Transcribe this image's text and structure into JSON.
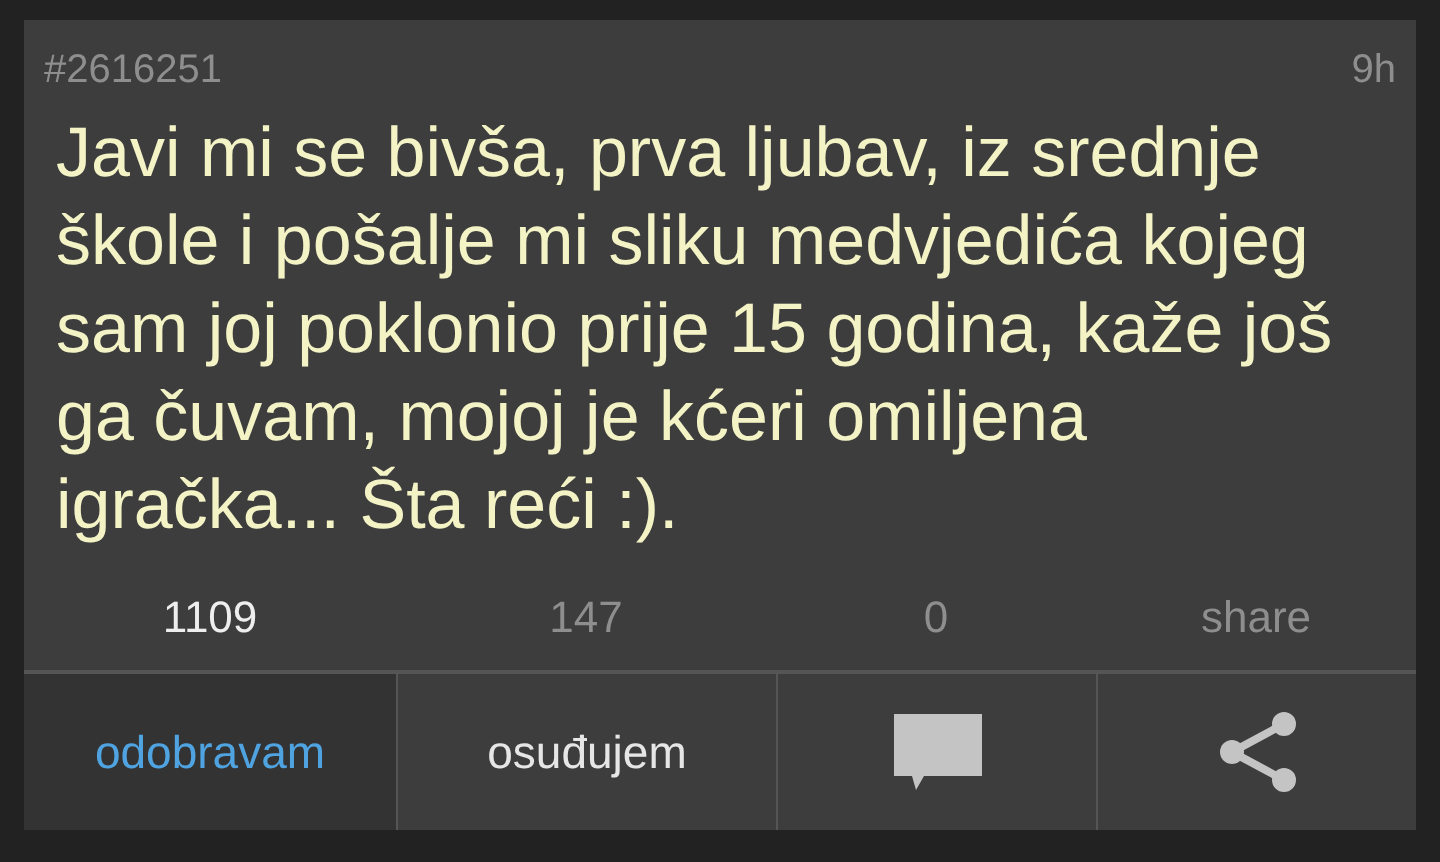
{
  "post": {
    "id": "#2616251",
    "age": "9h",
    "text": "Javi mi se bivša, prva ljubav, iz srednje škole i pošalje mi sliku medvjedića kojeg sam joj poklonio prije 15 godina, kaže još ga čuvam, mojoj je kćeri omiljena igračka... Šta reći :)."
  },
  "stats": [
    {
      "text": "1109",
      "active": true
    },
    {
      "text": "147",
      "active": false
    },
    {
      "text": "0",
      "active": false
    },
    {
      "text": "share",
      "active": false
    }
  ],
  "actions": [
    {
      "kind": "text",
      "label": "odobravam",
      "selected": true
    },
    {
      "kind": "text",
      "label": "osuđujem",
      "selected": false
    },
    {
      "kind": "comment",
      "selected": false
    },
    {
      "kind": "share",
      "selected": false
    }
  ]
}
